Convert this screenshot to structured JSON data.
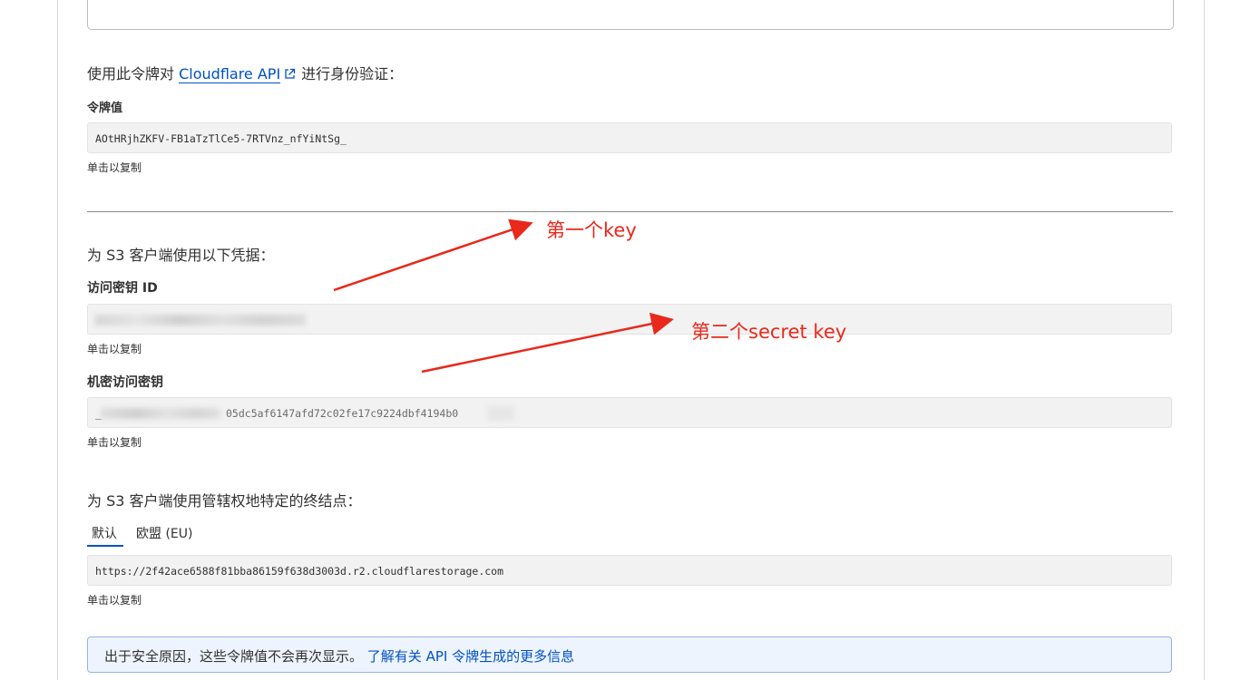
{
  "token_section": {
    "intro_prefix": "使用此令牌对",
    "intro_link": "Cloudflare API",
    "intro_suffix": "进行身份验证：",
    "token_label": "令牌值",
    "token_value": "AOtHRjhZKFV-FB1aTzTlCe5-7RTVnz_nfYiNtSg_",
    "copy_hint": "单击以复制"
  },
  "s3_section": {
    "intro": "为 S3 客户端使用以下凭据：",
    "access_key_label": "访问密钥 ID",
    "access_key_copy_hint": "单击以复制",
    "secret_key_label": "机密访问密钥",
    "secret_key_prefix": "_",
    "secret_key_visible_part": "05dc5af6147afd72c02fe17c9224dbf4194b0",
    "secret_key_copy_hint": "单击以复制"
  },
  "endpoint_section": {
    "intro": "为 S3 客户端使用管辖权地特定的终结点：",
    "tabs": [
      {
        "label": "默认",
        "active": true
      },
      {
        "label": "欧盟 (EU)",
        "active": false
      }
    ],
    "endpoint_value": "https://2f42ace6588f81bba86159f638d3003d.r2.cloudflarestorage.com",
    "copy_hint": "单击以复制"
  },
  "info_banner": {
    "text": "出于安全原因，这些令牌值不会再次显示。",
    "link": "了解有关 API 令牌生成的更多信息"
  },
  "annotations": {
    "first": "第一个key",
    "second": "第二个secret key",
    "color": "#e8291c"
  },
  "colors": {
    "link": "#0051c3",
    "code_bg": "#f2f2f2",
    "text": "#313131"
  }
}
